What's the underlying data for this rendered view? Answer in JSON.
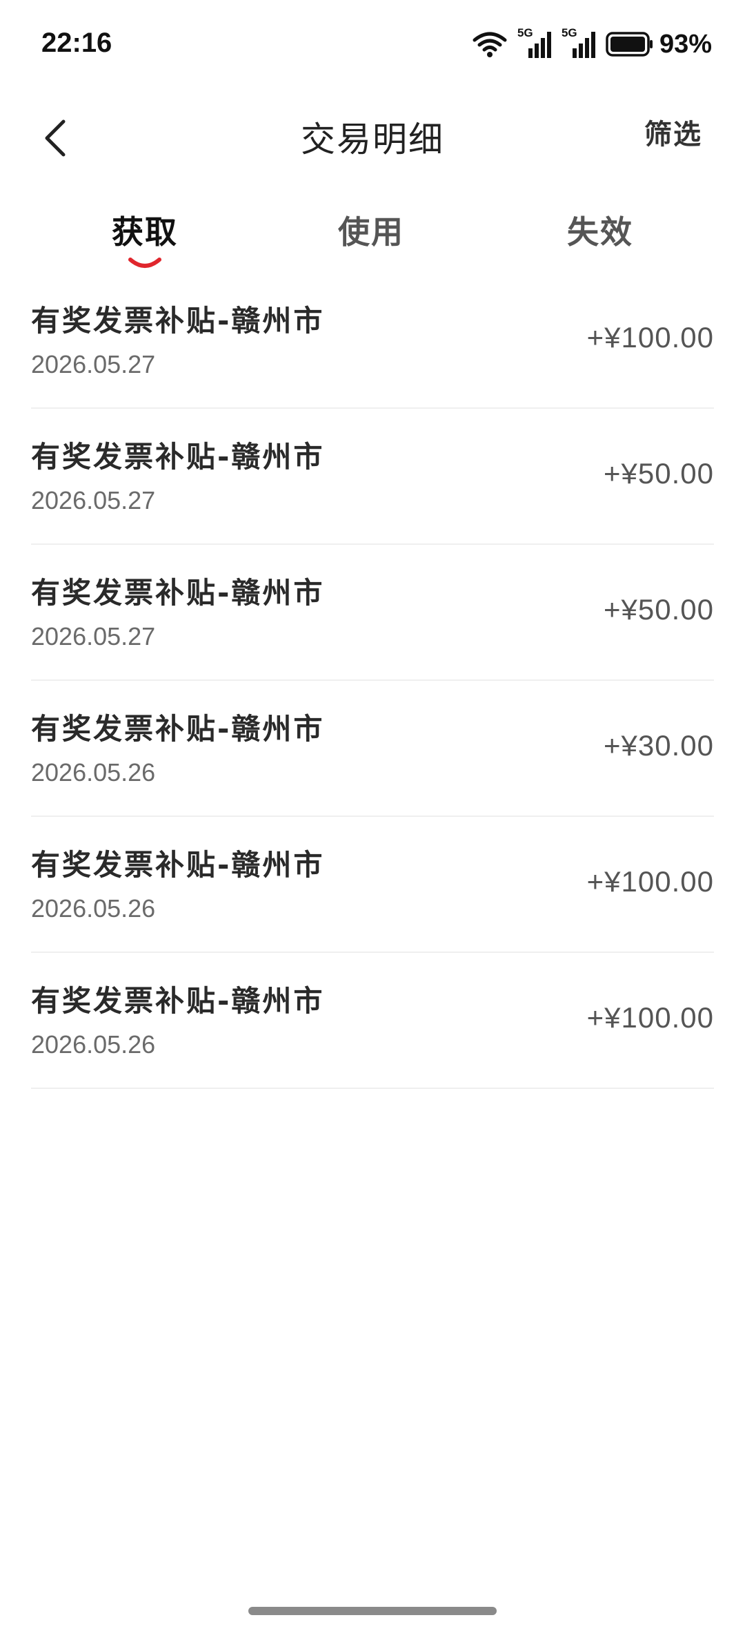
{
  "status_bar": {
    "time": "22:16",
    "battery_percent": "93%",
    "network_1": "5G",
    "network_2": "5G",
    "icons": [
      "wifi-icon",
      "signal-5g-icon",
      "signal-5g-icon",
      "battery-icon"
    ]
  },
  "header": {
    "back_icon": "chevron-left-icon",
    "title": "交易明细",
    "filter_label": "筛选"
  },
  "tabs": [
    {
      "label": "获取",
      "active": true
    },
    {
      "label": "使用",
      "active": false
    },
    {
      "label": "失效",
      "active": false
    }
  ],
  "colors": {
    "tab_indicator": "#e0262d",
    "amount": "#555555",
    "divider": "#efefef"
  },
  "transactions": [
    {
      "title": "有奖发票补贴-赣州市",
      "date": "2026.05.27",
      "amount": "+¥100.00"
    },
    {
      "title": "有奖发票补贴-赣州市",
      "date": "2026.05.27",
      "amount": "+¥50.00"
    },
    {
      "title": "有奖发票补贴-赣州市",
      "date": "2026.05.27",
      "amount": "+¥50.00"
    },
    {
      "title": "有奖发票补贴-赣州市",
      "date": "2026.05.26",
      "amount": "+¥30.00"
    },
    {
      "title": "有奖发票补贴-赣州市",
      "date": "2026.05.26",
      "amount": "+¥100.00"
    },
    {
      "title": "有奖发票补贴-赣州市",
      "date": "2026.05.26",
      "amount": "+¥100.00"
    }
  ]
}
